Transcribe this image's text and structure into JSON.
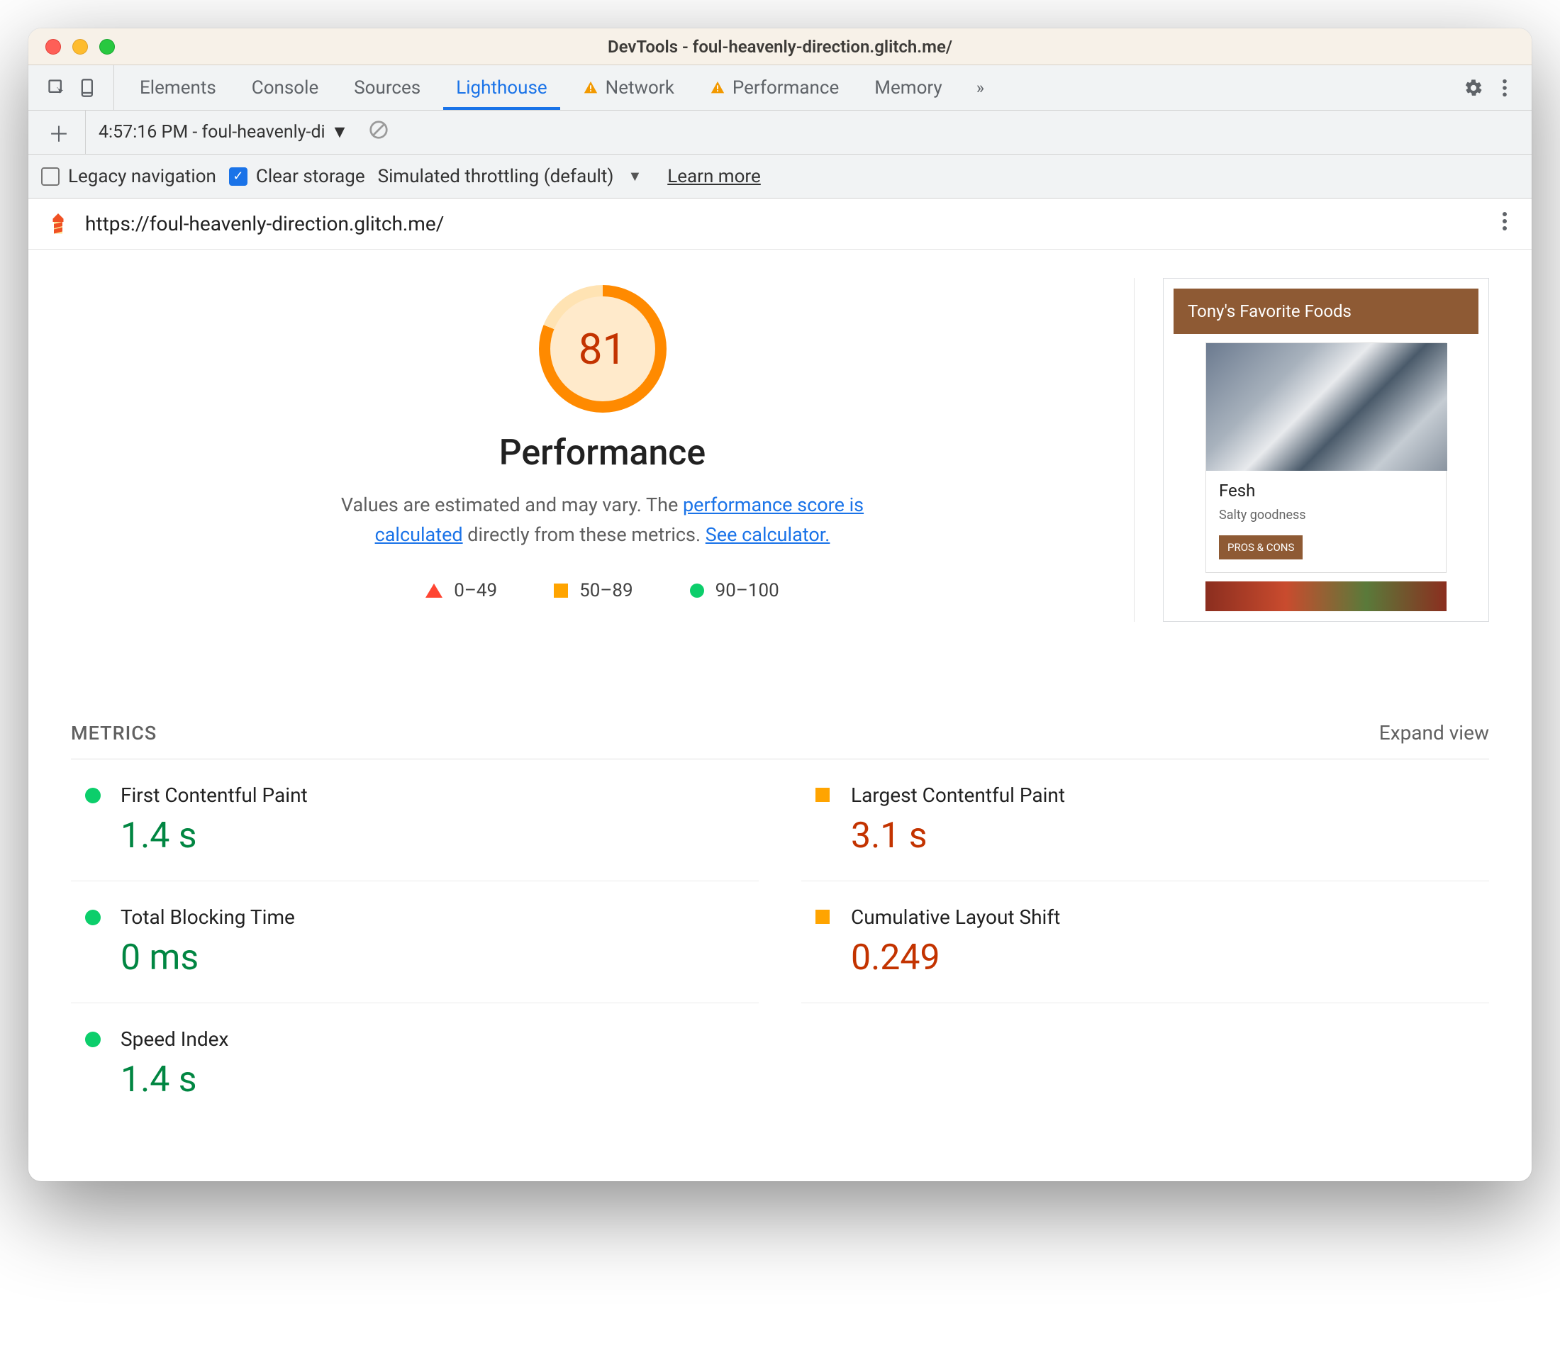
{
  "window_title": "DevTools - foul-heavenly-direction.glitch.me/",
  "tabs": {
    "elements": "Elements",
    "console": "Console",
    "sources": "Sources",
    "lighthouse": "Lighthouse",
    "network": "Network",
    "performance": "Performance",
    "memory": "Memory"
  },
  "toolbar": {
    "report_label": "4:57:16 PM - foul-heavenly-di",
    "legacy_nav": "Legacy navigation",
    "clear_storage": "Clear storage",
    "throttling": "Simulated throttling (default)",
    "learn_more": "Learn more"
  },
  "url": "https://foul-heavenly-direction.glitch.me/",
  "gauge": {
    "score": "81",
    "title": "Performance",
    "desc_pre": "Values are estimated and may vary. The ",
    "link1": "performance score is calculated",
    "desc_mid": " directly from these metrics. ",
    "link2": "See calculator."
  },
  "scale": {
    "bad": "0–49",
    "mid": "50–89",
    "good": "90–100"
  },
  "preview": {
    "header": "Tony's Favorite Foods",
    "card_title": "Fesh",
    "card_sub": "Salty goodness",
    "card_btn": "PROS & CONS"
  },
  "metrics_header": "METRICS",
  "expand_view": "Expand view",
  "metrics": {
    "fcp_name": "First Contentful Paint",
    "fcp_value": "1.4 s",
    "lcp_name": "Largest Contentful Paint",
    "lcp_value": "3.1 s",
    "tbt_name": "Total Blocking Time",
    "tbt_value": "0 ms",
    "cls_name": "Cumulative Layout Shift",
    "cls_value": "0.249",
    "si_name": "Speed Index",
    "si_value": "1.4 s"
  }
}
